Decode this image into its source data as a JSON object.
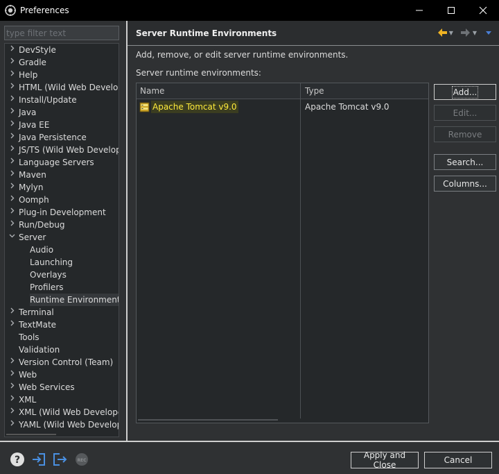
{
  "window": {
    "title": "Preferences",
    "minimize_icon": "minimize-icon",
    "maximize_icon": "maximize-icon",
    "close_icon": "close-icon"
  },
  "filter": {
    "placeholder": "type filter text",
    "value": ""
  },
  "tree": {
    "items": [
      {
        "label": "DevStyle",
        "expandable": true
      },
      {
        "label": "Gradle",
        "expandable": true
      },
      {
        "label": "Help",
        "expandable": true
      },
      {
        "label": "HTML (Wild Web Developer)",
        "expandable": true
      },
      {
        "label": "Install/Update",
        "expandable": true
      },
      {
        "label": "Java",
        "expandable": true
      },
      {
        "label": "Java EE",
        "expandable": true
      },
      {
        "label": "Java Persistence",
        "expandable": true
      },
      {
        "label": "JS/TS (Wild Web Developer)",
        "expandable": true
      },
      {
        "label": "Language Servers",
        "expandable": true
      },
      {
        "label": "Maven",
        "expandable": true
      },
      {
        "label": "Mylyn",
        "expandable": true
      },
      {
        "label": "Oomph",
        "expandable": true
      },
      {
        "label": "Plug-in Development",
        "expandable": true
      },
      {
        "label": "Run/Debug",
        "expandable": true
      },
      {
        "label": "Server",
        "expandable": true,
        "expanded": true
      },
      {
        "label": "Audio",
        "child": true
      },
      {
        "label": "Launching",
        "child": true
      },
      {
        "label": "Overlays",
        "child": true
      },
      {
        "label": "Profilers",
        "child": true
      },
      {
        "label": "Runtime Environments",
        "child": true,
        "selected": true
      },
      {
        "label": "Terminal",
        "expandable": true
      },
      {
        "label": "TextMate",
        "expandable": true
      },
      {
        "label": "Tools",
        "expandable": false
      },
      {
        "label": "Validation",
        "expandable": false
      },
      {
        "label": "Version Control (Team)",
        "expandable": true
      },
      {
        "label": "Web",
        "expandable": true
      },
      {
        "label": "Web Services",
        "expandable": true
      },
      {
        "label": "XML",
        "expandable": true
      },
      {
        "label": "XML (Wild Web Developer)",
        "expandable": true
      },
      {
        "label": "YAML (Wild Web Developer)",
        "expandable": true
      }
    ]
  },
  "page": {
    "title": "Server Runtime Environments",
    "description": "Add, remove, or edit server runtime environments.",
    "list_label": "Server runtime environments:",
    "nav": {
      "back_icon": "back-arrow-icon",
      "forward_icon": "forward-arrow-icon",
      "menu_icon": "view-menu-icon"
    },
    "table": {
      "columns": [
        "Name",
        "Type"
      ],
      "rows": [
        {
          "name": "Apache Tomcat v9.0",
          "type": "Apache Tomcat v9.0",
          "icon": "server-runtime-icon"
        }
      ]
    },
    "buttons": {
      "add": "Add...",
      "edit": "Edit...",
      "remove": "Remove",
      "search": "Search...",
      "columns": "Columns..."
    }
  },
  "footer": {
    "help_icon": "help-icon",
    "import_icon": "import-icon",
    "export_icon": "export-icon",
    "record_icon": "record-icon",
    "apply_close": "Apply and Close",
    "cancel": "Cancel"
  },
  "colors": {
    "accent_yellow": "#ffeb3b",
    "back_arrow": "#f0b323",
    "nav_blue": "#4a7fd6",
    "bottom_icon_blue": "#4a90e2"
  }
}
